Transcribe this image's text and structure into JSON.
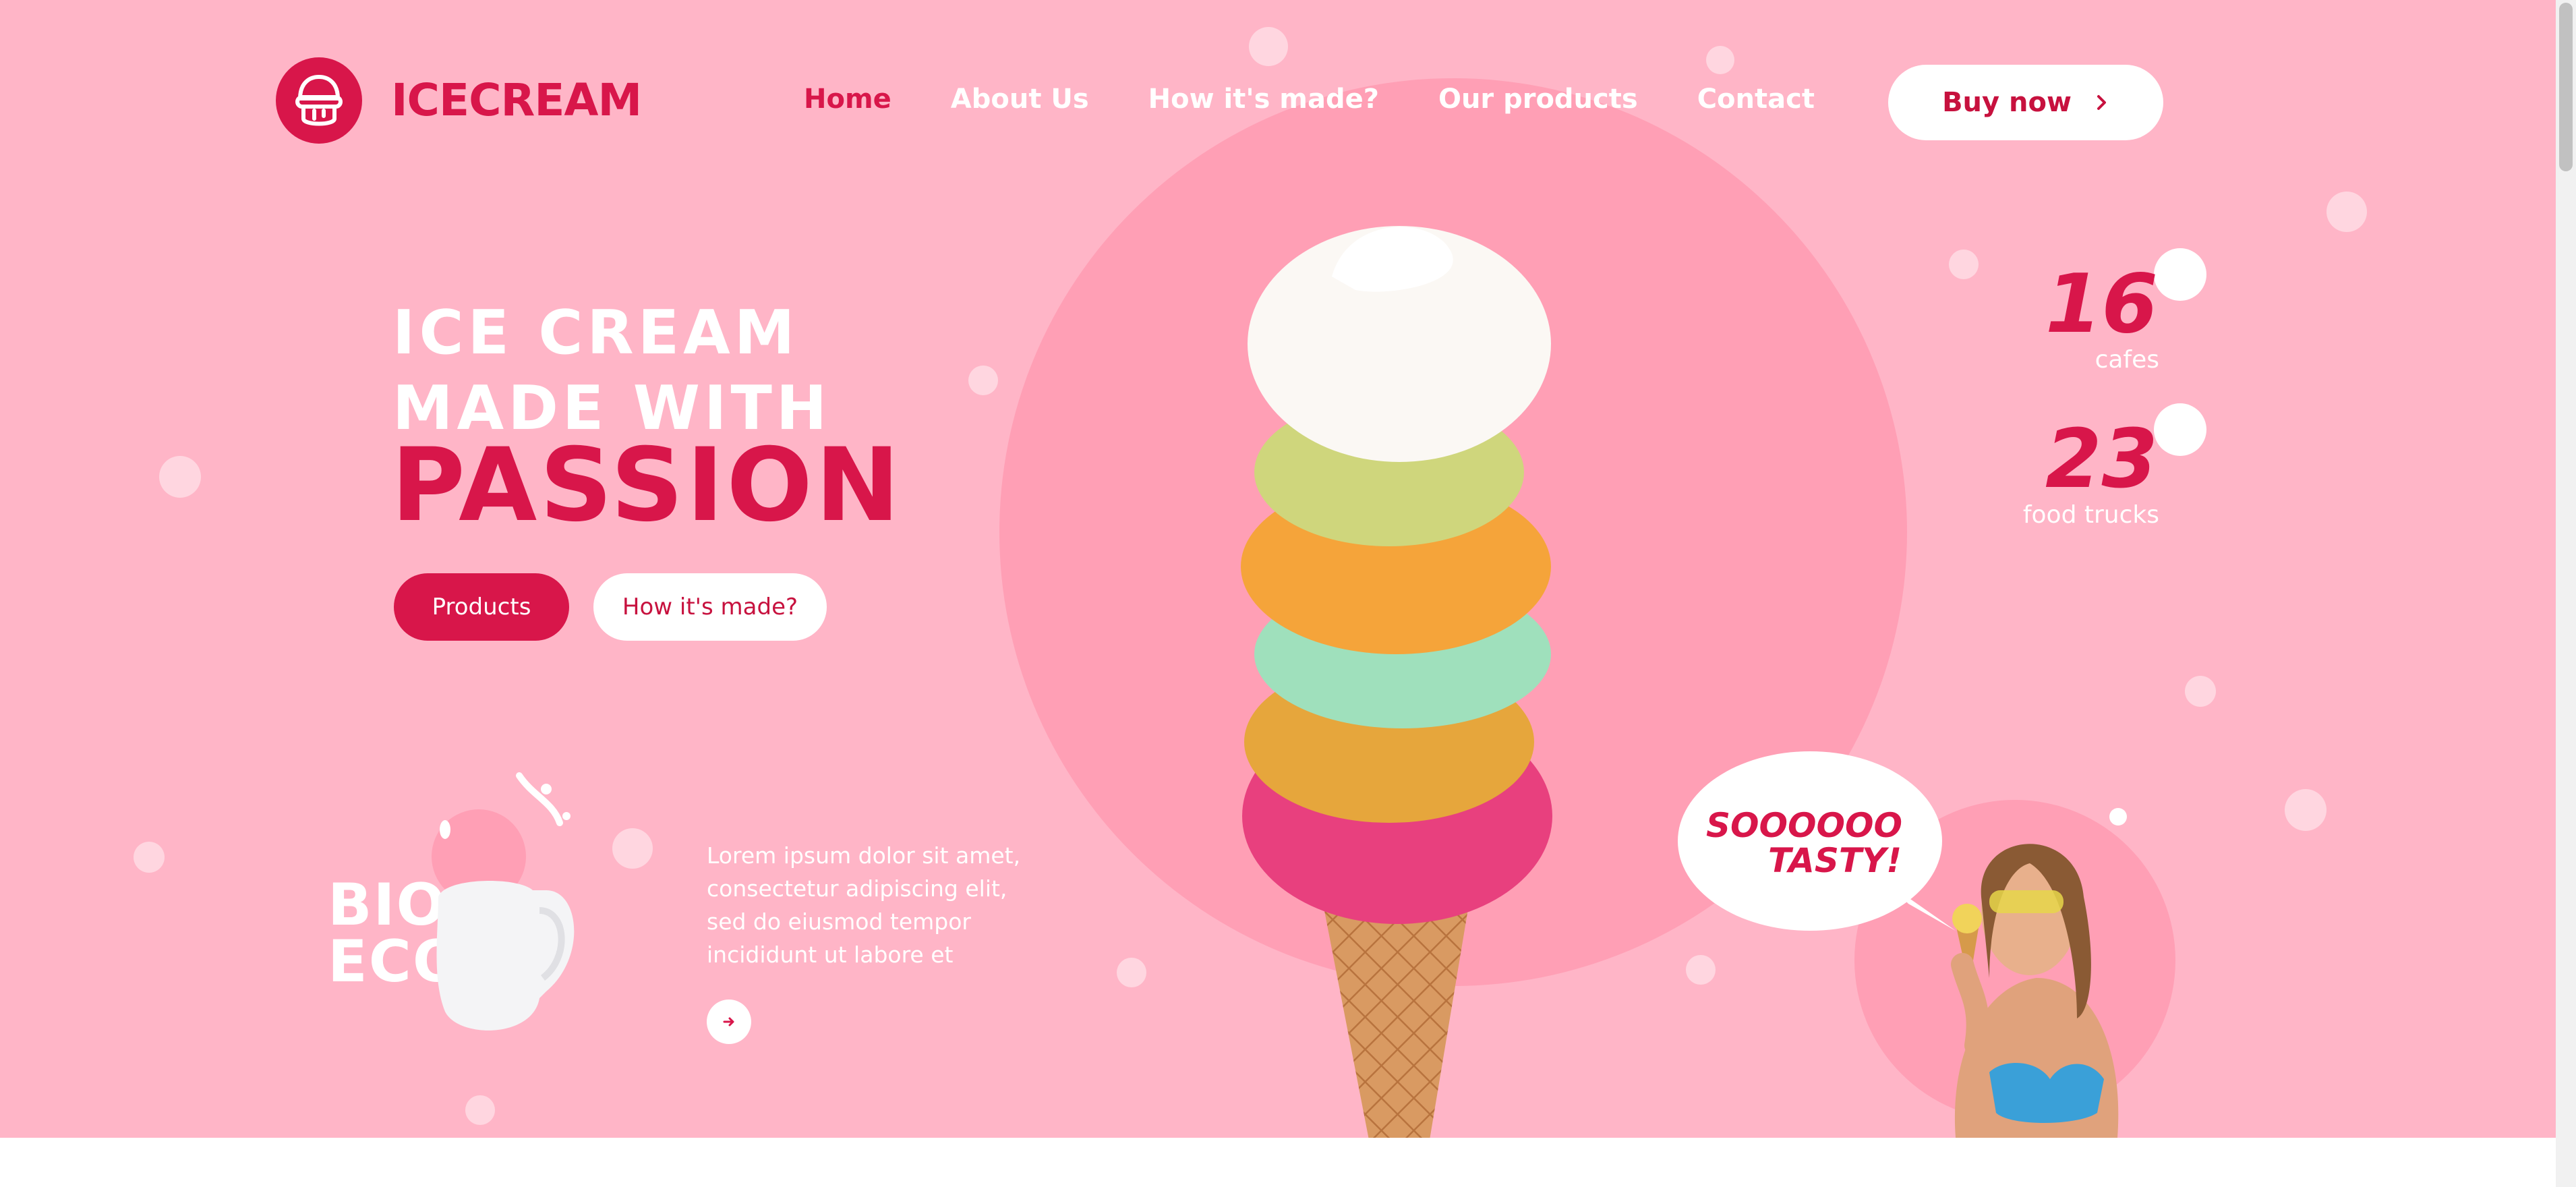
{
  "brand": {
    "name": "ICECREAM",
    "logo_icon": "ice-cream-logo-icon",
    "color": "#d8164a"
  },
  "nav": [
    {
      "label": "Home",
      "active": true
    },
    {
      "label": "About Us",
      "active": false
    },
    {
      "label": "How it's made?",
      "active": false
    },
    {
      "label": "Our products",
      "active": false
    },
    {
      "label": "Contact",
      "active": false
    }
  ],
  "buy_button": {
    "label": "Buy now",
    "icon": "chevron-right-icon"
  },
  "headline": {
    "line1": "ICE CREAM",
    "line2": "MADE WITH",
    "line3": "PASSION"
  },
  "cta": {
    "primary": "Products",
    "secondary": "How it's made?"
  },
  "stats": [
    {
      "value": "16",
      "label": "cafes"
    },
    {
      "value": "23",
      "label": "food trucks"
    }
  ],
  "bio": {
    "text_line1": "BIO",
    "text_line2": "ECO"
  },
  "description": {
    "line1": "Lorem ipsum dolor sit amet,",
    "line2": "consectetur adipiscing elit,",
    "line3": "sed do eiusmod tempor",
    "line4": "incididunt ut labore et",
    "more_icon": "arrow-right-icon"
  },
  "speech": {
    "line1": "SOOOOOO",
    "line2": "TASTY!"
  },
  "colors": {
    "background": "#ffb5c7",
    "circle": "#ff9fb5",
    "accent": "#d8164a",
    "white": "#ffffff"
  }
}
